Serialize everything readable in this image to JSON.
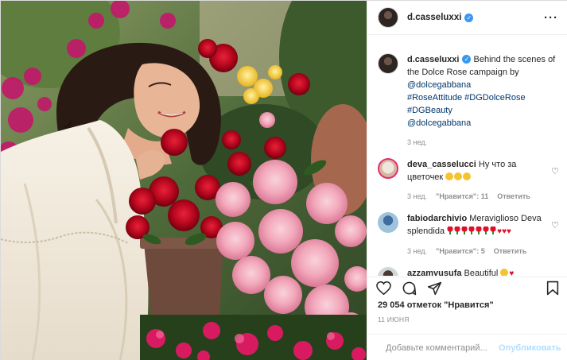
{
  "post": {
    "username": "d.casseluxxi",
    "verified": true,
    "more_icon": "more-dots-icon"
  },
  "caption": {
    "username": "d.casseluxxi",
    "text": "Behind the scenes of the Dolce Rose campaign by",
    "mention1": "@dolcegabbana",
    "hashtags": "#RoseAttitude #DGDolceRose",
    "hashtag3": "#DGBeauty",
    "mention2": "@dolcegabbana",
    "time": "3 нед."
  },
  "comments": [
    {
      "username": "deva_casselucci",
      "text": "Ну что за цветочек",
      "emoji": "heart-eyes x3",
      "time": "3 нед.",
      "likes": "\"Нравится\": 11",
      "reply": "Ответить"
    },
    {
      "username": "fabiodarchivio",
      "text": "Meraviglioso Deva splendida",
      "emoji": "roses x7, red hearts x3",
      "time": "3 нед.",
      "likes": "\"Нравится\": 5",
      "reply": "Ответить"
    },
    {
      "username": "azzamyusufa",
      "text": "Beautiful",
      "emoji": "heart-eyes, red heart"
    }
  ],
  "actions": {
    "like_icon": "heart-outline-icon",
    "comment_icon": "comment-icon",
    "share_icon": "share-paper-plane-icon",
    "save_icon": "bookmark-icon"
  },
  "likes_text": "29 054 отметок \"Нравится\"",
  "date": "11 ИЮНЯ",
  "add_comment": {
    "placeholder": "Добавьте комментарий...",
    "post_label": "Опубликовать",
    "emoji_icon": "smiley-icon"
  },
  "colors": {
    "link": "#00376b",
    "verified": "#3897f0",
    "post_button_disabled": "#b2dffc",
    "muted": "#8e8e8e"
  }
}
